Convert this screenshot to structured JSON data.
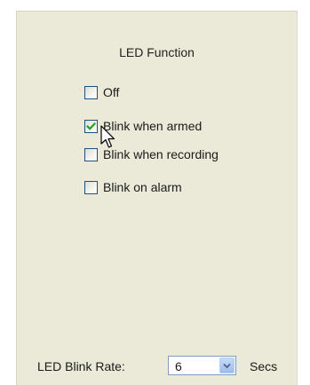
{
  "panel": {
    "title": "LED Function"
  },
  "options": [
    {
      "label": "Off",
      "checked": false
    },
    {
      "label": "Blink when armed",
      "checked": true
    },
    {
      "label": "Blink when recording",
      "checked": false
    },
    {
      "label": "Blink on alarm",
      "checked": false
    }
  ],
  "blink_rate": {
    "label": "LED Blink Rate:",
    "value": "6",
    "unit": "Secs"
  },
  "colors": {
    "panel_bg": "#ebe9d8",
    "checkbox_border": "#1c5180",
    "checkmark": "#21a121",
    "dropdown_border": "#7f9db9",
    "dropdown_button": "#b4cbf5"
  },
  "icons": {
    "checkmark": "checkmark-icon",
    "cursor": "mouse-pointer-icon",
    "dropdown": "chevron-down-icon"
  }
}
